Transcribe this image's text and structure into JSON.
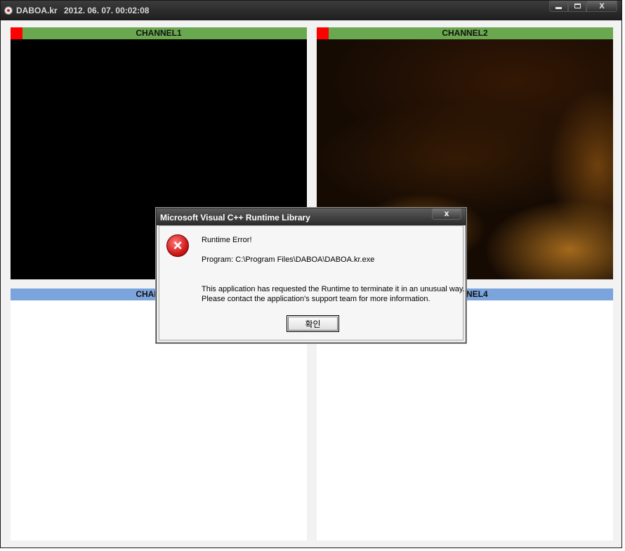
{
  "window": {
    "app_title": "DABOA.kr",
    "datetime": "2012. 06. 07. 00:02:08",
    "controls": {
      "minimize_icon": "minimize-icon",
      "maximize_icon": "maximize-icon",
      "close_glyph": "X"
    }
  },
  "channels": [
    {
      "label": "CHANNEL1",
      "header_color": "#6aa84f",
      "recording": true,
      "view": "black"
    },
    {
      "label": "CHANNEL2",
      "header_color": "#6aa84f",
      "recording": true,
      "view": "camera-feed"
    },
    {
      "label": "CHANNEL3",
      "header_color": "#7ba4dc",
      "recording": false,
      "view": "empty"
    },
    {
      "label": "CHANNEL4",
      "header_color": "#7ba4dc",
      "recording": false,
      "view": "empty"
    }
  ],
  "dialog": {
    "title": "Microsoft Visual C++ Runtime Library",
    "close_glyph": "x",
    "icon": "error-icon",
    "line1": "Runtime Error!",
    "line2": "Program: C:\\Program Files\\DABOA\\DABOA.kr.exe",
    "line3": "This application has requested the Runtime to terminate it in an unusual way.",
    "line4": "Please contact the application's support team for more information.",
    "ok_label": "확인"
  },
  "colors": {
    "record": "#ff0000",
    "active_header": "#6aa84f",
    "inactive_header": "#7ba4dc"
  }
}
